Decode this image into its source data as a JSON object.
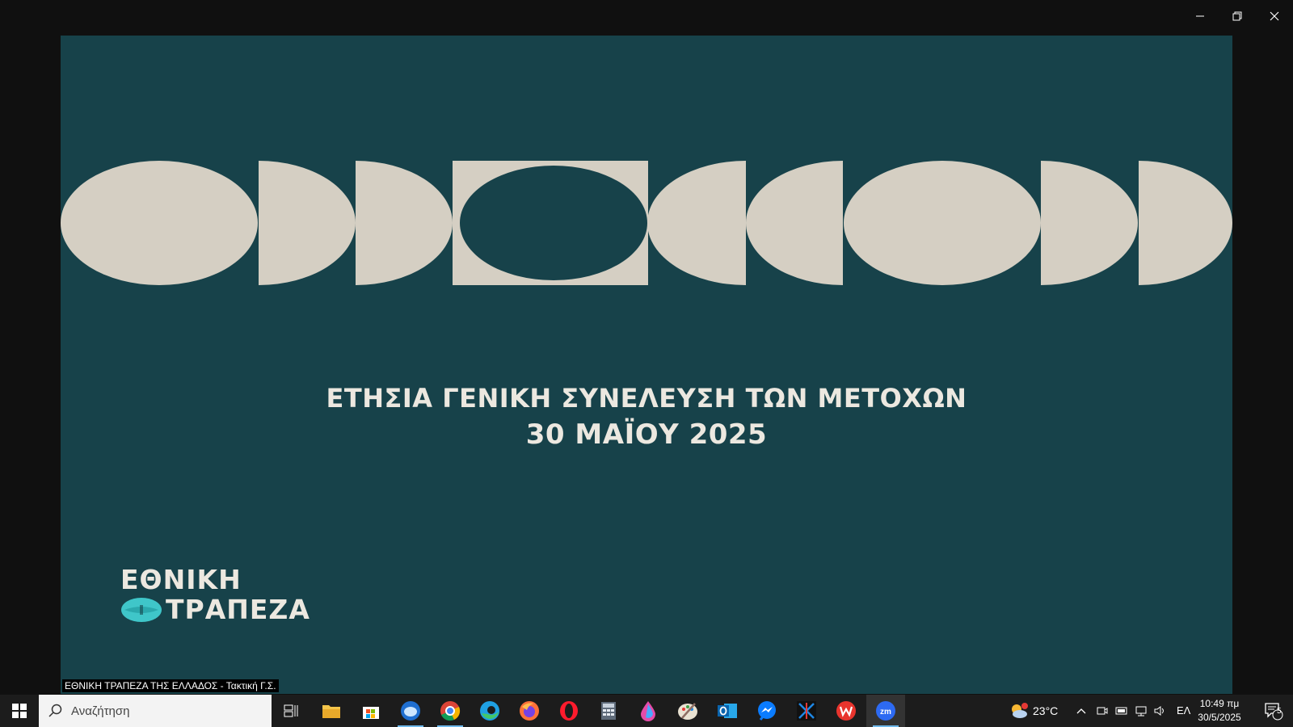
{
  "window": {
    "controls": [
      "minimize",
      "restore",
      "close"
    ]
  },
  "video": {
    "headline_line1": "ΕΤΗΣΙΑ ΓΕΝΙΚΗ ΣΥΝΕΛΕΥΣΗ ΤΩΝ ΜΕΤΟΧΩΝ",
    "headline_line2": "30 ΜΑΪΟΥ 2025",
    "logo_word1": "ΕΘΝΙΚΗ",
    "logo_word2": "ΤΡΑΠΕΖΑ",
    "caption": "ΕΘΝΙΚΗ ΤΡΑΠΕΖΑ ΤΗΣ ΕΛΛΑΔΟΣ - Τακτική Γ.Σ.",
    "colors": {
      "background": "#17424a",
      "shapes": "#d5cfc3",
      "logo_mark": "#3fc6c9"
    }
  },
  "taskbar": {
    "search_placeholder": "Αναζήτηση",
    "apps": [
      "start",
      "search",
      "task-view",
      "file-explorer",
      "microsoft-store",
      "thunderbird",
      "chrome",
      "edge",
      "firefox",
      "opera",
      "calculator",
      "color-app",
      "paint",
      "outlook",
      "messenger",
      "opap",
      "wps-office",
      "zoom"
    ],
    "active_app": "zoom",
    "weather": {
      "temperature": "23°C",
      "badge": "1"
    },
    "language": "ΕΛ",
    "time": "10:49 πμ",
    "date": "30/5/2025",
    "notifications_count": "5"
  }
}
